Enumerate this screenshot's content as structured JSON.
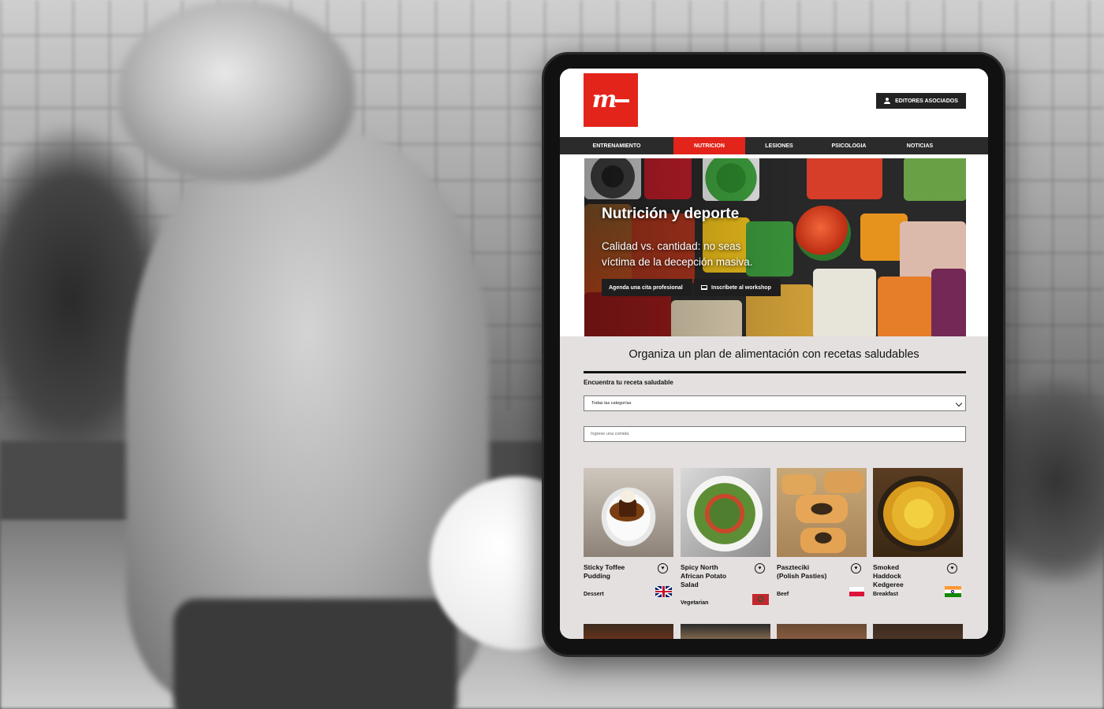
{
  "header": {
    "logo_text": "m",
    "editors_label": "EDITORES ASOCIADOS"
  },
  "nav": {
    "items": [
      {
        "label": "ENTRENAMIENTO",
        "active": false
      },
      {
        "label": "NUTRICION",
        "active": true
      },
      {
        "label": "LESIONES",
        "active": false
      },
      {
        "label": "PSICOLOGIA",
        "active": false
      },
      {
        "label": "NOTICIAS",
        "active": false
      }
    ]
  },
  "hero": {
    "title": "Nutrición y deporte",
    "subtitle": "Calidad vs. cantidad: no seas víctima de la decepción masiva.",
    "button_appointment": "Agenda una cita profesional",
    "button_workshop": "Inscríbete al workshop"
  },
  "recipes_section": {
    "title": "Organiza un plan de alimentación con recetas saludables",
    "find_label": "Encuentra tu receta saludable",
    "category_select_value": "Todas las categorías",
    "search_placeholder": "Ingrese una comida"
  },
  "recipes": [
    {
      "name": "Sticky Toffee Pudding",
      "category": "Dessert",
      "flag": "uk-flag-icon"
    },
    {
      "name": "Spicy North African Potato Salad",
      "category": "Vegetarian",
      "flag": "morocco-flag-icon"
    },
    {
      "name": "Paszteciki (Polish Pasties)",
      "category": "Beef",
      "flag": "poland-flag-icon"
    },
    {
      "name": "Smoked Haddock Kedgeree",
      "category": "Breakfast",
      "flag": "india-flag-icon"
    }
  ],
  "colors": {
    "brand_red": "#e3241b",
    "nav_dark": "#2b2b2b",
    "content_bg": "#e5e0e0"
  }
}
